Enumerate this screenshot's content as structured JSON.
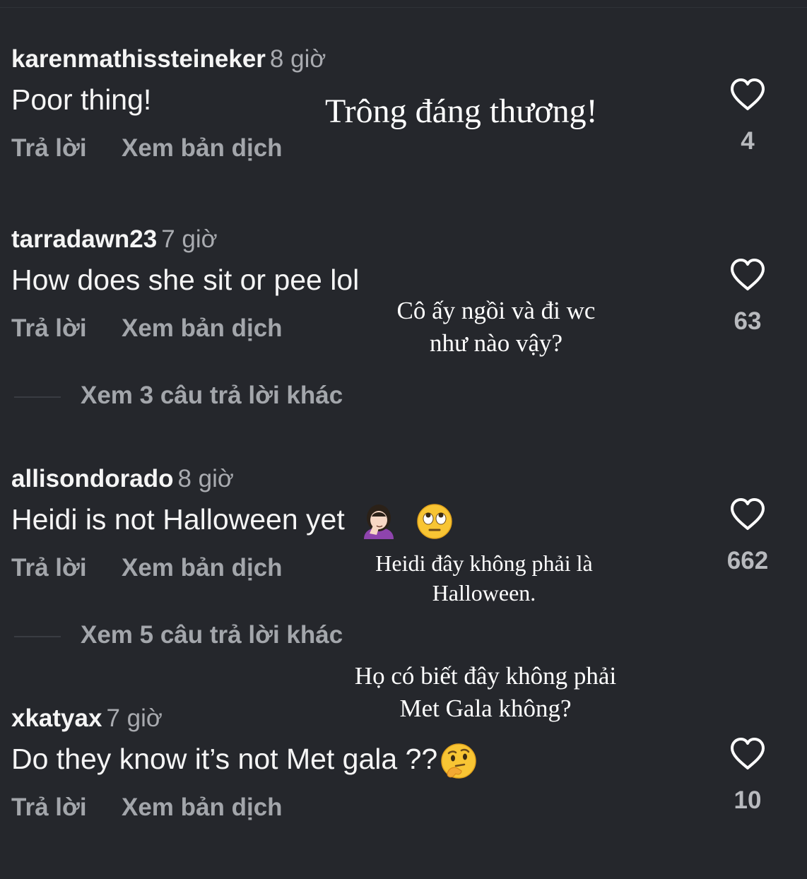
{
  "comments": [
    {
      "username": "karenmathissteineker",
      "time": "8 giờ",
      "text": "Poor thing!",
      "reply_label": "Trả lời",
      "translate_label": "Xem bản dịch",
      "likes": "4"
    },
    {
      "username": "tarradawn23",
      "time": "7 giờ",
      "text": "How does she sit or pee lol",
      "reply_label": "Trả lời",
      "translate_label": "Xem bản dịch",
      "likes": "63",
      "more_replies": "Xem 3 câu trả lời khác"
    },
    {
      "username": "allisondorado",
      "time": "8 giờ",
      "text": "Heidi is not Halloween yet",
      "emojis": [
        "facepalm-woman-emoji",
        "eye-roll-emoji"
      ],
      "reply_label": "Trả lời",
      "translate_label": "Xem bản dịch",
      "likes": "662",
      "more_replies": "Xem 5 câu trả lời khác"
    },
    {
      "username": "xkatyax",
      "time": "7 giờ",
      "text": "Do they know it’s not Met gala ??",
      "emojis": [
        "thinking-face-emoji"
      ],
      "reply_label": "Trả lời",
      "translate_label": "Xem bản dịch",
      "likes": "10"
    }
  ],
  "translations": {
    "t1": "Trông đáng thương!",
    "t2_line1": "Cô ấy ngồi và đi wc",
    "t2_line2": "như nào vậy?",
    "t3_line1": "Heidi đây không phải là",
    "t3_line2": "Halloween.",
    "t4_line1": "Họ có biết đây không phải",
    "t4_line2": "Met Gala không?"
  },
  "colors": {
    "background": "#25272c",
    "primary_text": "#f5f5f5",
    "secondary_text": "#a3a6ab",
    "heart_outline": "#ffffff"
  }
}
